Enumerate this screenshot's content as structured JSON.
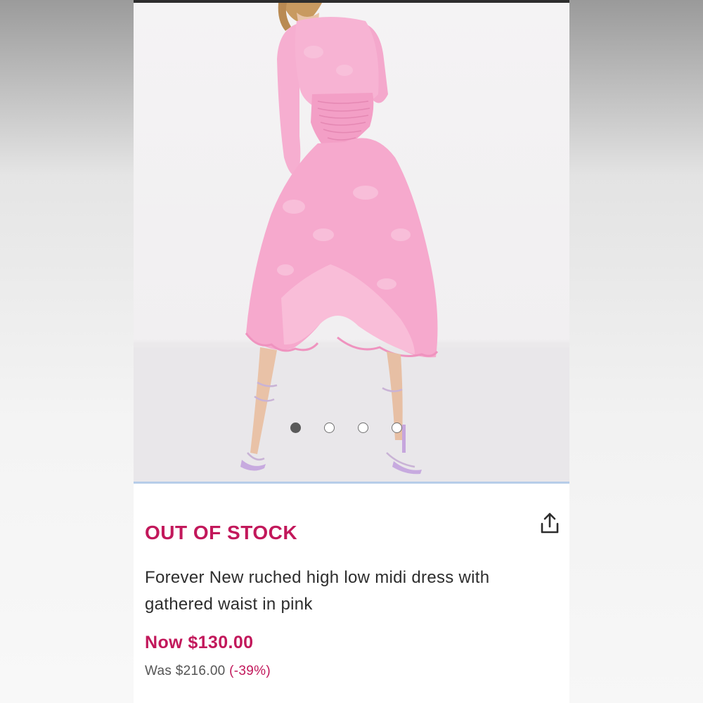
{
  "product": {
    "stock_status": "OUT OF STOCK",
    "title": "Forever New ruched high low midi dress with gathered waist in pink",
    "price_now": "Now $130.00",
    "price_was": "Was $216.00",
    "discount": "(-39%)"
  },
  "gallery": {
    "image_subject": "pink-dress-model-photo",
    "dot_count": 4,
    "active_index": 0
  },
  "colors": {
    "accent": "#c2185b",
    "dress": "#f4a6c8",
    "text": "#2d2d2d"
  },
  "icons": {
    "share": "share-icon"
  }
}
